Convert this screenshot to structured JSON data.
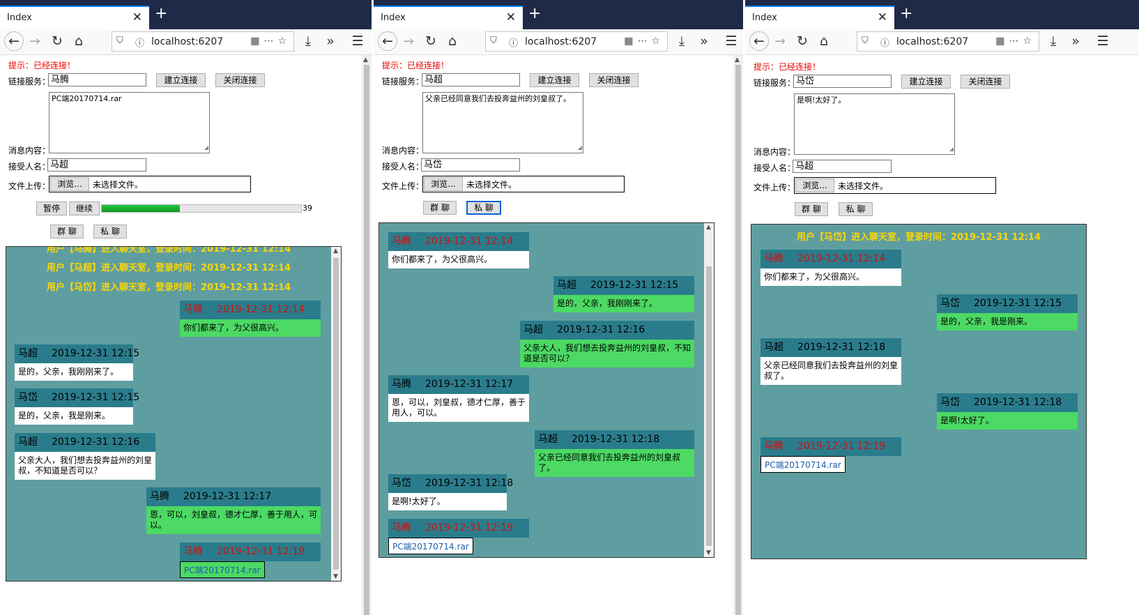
{
  "browser": {
    "tab_title": "Index",
    "url": "localhost:6207"
  },
  "labels": {
    "hint": "提示：已经连接！",
    "service": "链接服务：",
    "connect": "建立连接",
    "close_conn": "关闭连接",
    "message": "消息内容：",
    "receiver": "接受人名：",
    "upload": "文件上传：",
    "browse": "浏览...",
    "no_file": "未选择文件。",
    "pause": "暂停",
    "resume": "继续",
    "group_chat": "群 聊",
    "private_chat": "私 聊"
  },
  "windows": [
    {
      "user": "马腾",
      "message_text": "PC端20170714.rar",
      "receiver": "马超",
      "progress": {
        "percent": 39,
        "label": "39"
      },
      "system_messages": [
        "用户【马腾】进入聊天室，登录时间：2019-12-31 12:14",
        "用户【马超】进入聊天室，登录时间：2019-12-31 12:14",
        "用户【马岱】进入聊天室，登录时间：2019-12-31 12:14"
      ],
      "messages": [
        {
          "name": "马腾",
          "time": "2019-12-31 12:14",
          "text": "你们都来了，为父很高兴。"
        },
        {
          "name": "马超",
          "time": "2019-12-31 12:15",
          "text": "是的，父亲，我刚刚来了。"
        },
        {
          "name": "马岱",
          "time": "2019-12-31 12:15",
          "text": "是的，父亲，我是刚来。"
        },
        {
          "name": "马超",
          "time": "2019-12-31 12:16",
          "text": "父亲大人，我们想去投奔益州的刘皇叔，不知道是否可以？"
        },
        {
          "name": "马腾",
          "time": "2019-12-31 12:17",
          "text": "恩，可以，刘皇叔，德才仁厚，善于用人，可以。"
        },
        {
          "name": "马腾",
          "time": "2019-12-31 12:19",
          "text": "PC端20170714.rar"
        }
      ]
    },
    {
      "user": "马超",
      "message_text": "父亲已经同意我们去投奔益州的刘皇叔了。",
      "receiver": "马岱",
      "messages": [
        {
          "name": "马腾",
          "time": "2019-12-31 12:14",
          "text": "你们都来了，为父很高兴。"
        },
        {
          "name": "马超",
          "time": "2019-12-31 12:15",
          "text": "是的，父亲，我刚刚来了。"
        },
        {
          "name": "马超",
          "time": "2019-12-31 12:16",
          "text": "父亲大人，我们想去投奔益州的刘皇叔，不知道是否可以？"
        },
        {
          "name": "马腾",
          "time": "2019-12-31 12:17",
          "text": "恩，可以，刘皇叔，德才仁厚，善于用人，可以。"
        },
        {
          "name": "马超",
          "time": "2019-12-31 12:18",
          "text": "父亲已经同意我们去投奔益州的刘皇叔了。"
        },
        {
          "name": "马岱",
          "time": "2019-12-31 12:18",
          "text": "是啊!太好了。"
        },
        {
          "name": "马腾",
          "time": "2019-12-31 12:19",
          "text": "PC端20170714.rar"
        }
      ]
    },
    {
      "user": "马岱",
      "message_text": "是啊!太好了。",
      "receiver": "马超",
      "system_messages": [
        "用户【马岱】进入聊天室，登录时间：2019-12-31 12:14"
      ],
      "messages": [
        {
          "name": "马腾",
          "time": "2019-12-31 12:14",
          "text": "你们都来了，为父很高兴。"
        },
        {
          "name": "马岱",
          "time": "2019-12-31 12:15",
          "text": "是的，父亲，我是刚来。"
        },
        {
          "name": "马超",
          "time": "2019-12-31 12:18",
          "text": "父亲已经同意我们去投奔益州的刘皇叔了。"
        },
        {
          "name": "马岱",
          "time": "2019-12-31 12:18",
          "text": "是啊!太好了。"
        },
        {
          "name": "马腾",
          "time": "2019-12-31 12:19",
          "text": "PC端20170714.rar"
        }
      ]
    }
  ]
}
